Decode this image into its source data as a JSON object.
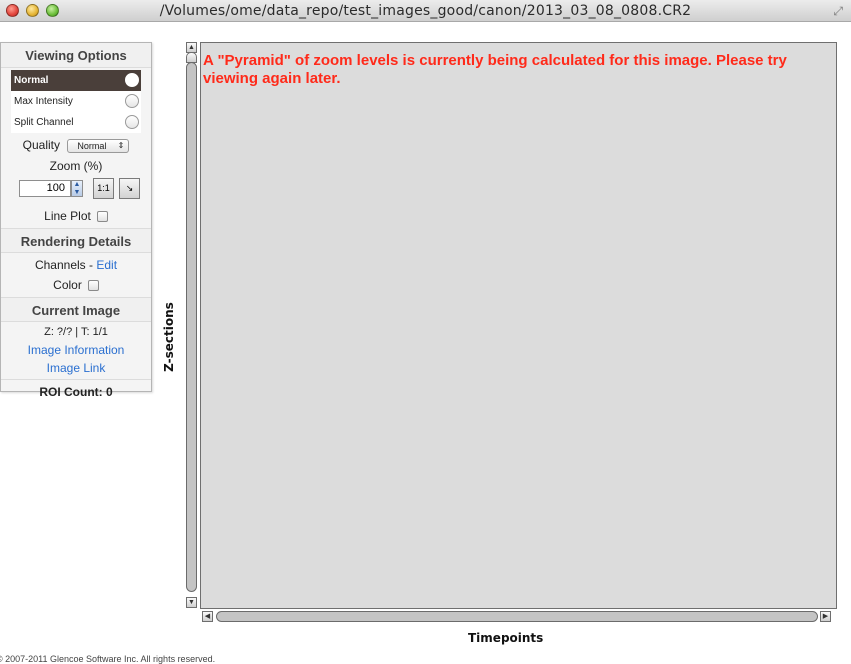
{
  "window": {
    "title": "/Volumes/ome/data_repo/test_images_good/canon/2013_03_08_0808.CR2"
  },
  "viewing_options": {
    "heading": "Viewing Options",
    "modes": [
      "Normal",
      "Max Intensity",
      "Split Channel"
    ],
    "selected_mode": "Normal",
    "quality_label": "Quality",
    "quality_value": "Normal",
    "zoom_label": "Zoom (%)",
    "zoom_value": "100",
    "actual_size_button": "1:1",
    "line_plot_label": "Line Plot"
  },
  "rendering_details": {
    "heading": "Rendering Details",
    "channels_label": "Channels - ",
    "edit_link": "Edit",
    "color_label": "Color"
  },
  "current_image": {
    "heading": "Current Image",
    "zt_status": "Z: ?/? | T: 1/1",
    "image_information_link": "Image Information",
    "image_link": "Image Link",
    "roi_count": "ROI Count: 0"
  },
  "viewer": {
    "message": "A \"Pyramid\" of zoom levels is currently being calculated for this image. Please try viewing again later.",
    "z_axis_label": "Z-sections",
    "t_axis_label": "Timepoints"
  },
  "footer": {
    "copyright": "© 2007-2011 Glencoe Software Inc. All rights reserved."
  },
  "colors": {
    "message": "#ff2a1a",
    "selected_mode_bg": "#4a3f3a",
    "link": "#2a6fd0",
    "viewer_bg": "#dcdcdc"
  }
}
